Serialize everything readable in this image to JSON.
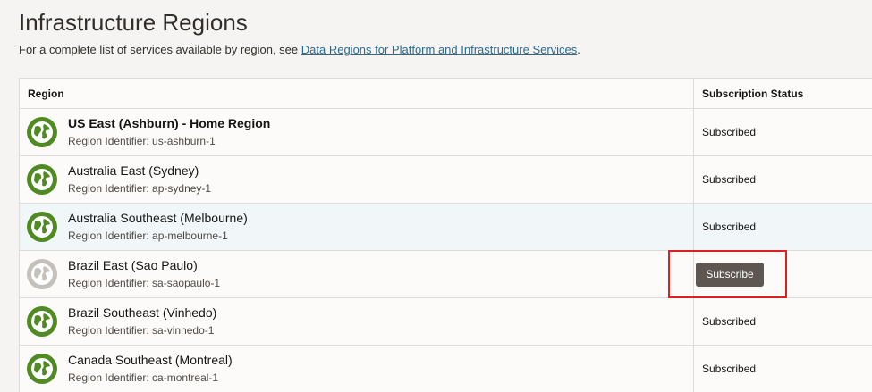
{
  "page": {
    "title": "Infrastructure Regions",
    "intro_text": "For a complete list of services available by region, see ",
    "intro_link": "Data Regions for Platform and Infrastructure Services",
    "intro_suffix": "."
  },
  "table": {
    "headers": {
      "region": "Region",
      "status": "Subscription Status"
    },
    "rows": [
      {
        "name": "US East (Ashburn) - Home Region",
        "identifier": "Region Identifier: us-ashburn-1",
        "status": "Subscribed"
      },
      {
        "name": "Australia East (Sydney)",
        "identifier": "Region Identifier: ap-sydney-1",
        "status": "Subscribed"
      },
      {
        "name": "Australia Southeast (Melbourne)",
        "identifier": "Region Identifier: ap-melbourne-1",
        "status": "Subscribed"
      },
      {
        "name": "Brazil East (Sao Paulo)",
        "identifier": "Region Identifier: sa-saopaulo-1",
        "status": "Subscribe"
      },
      {
        "name": "Brazil Southeast (Vinhedo)",
        "identifier": "Region Identifier: sa-vinhedo-1",
        "status": "Subscribed"
      },
      {
        "name": "Canada Southeast (Montreal)",
        "identifier": "Region Identifier: ca-montreal-1",
        "status": "Subscribed"
      }
    ]
  },
  "icons": {
    "region": "globe-icon"
  },
  "colors": {
    "subscribed_globe": "#4f8a22",
    "unsubscribed_globe": "#c4c0bc",
    "highlight_box": "#e0201f",
    "button": "#5e5650",
    "link": "#2b6b8e"
  }
}
